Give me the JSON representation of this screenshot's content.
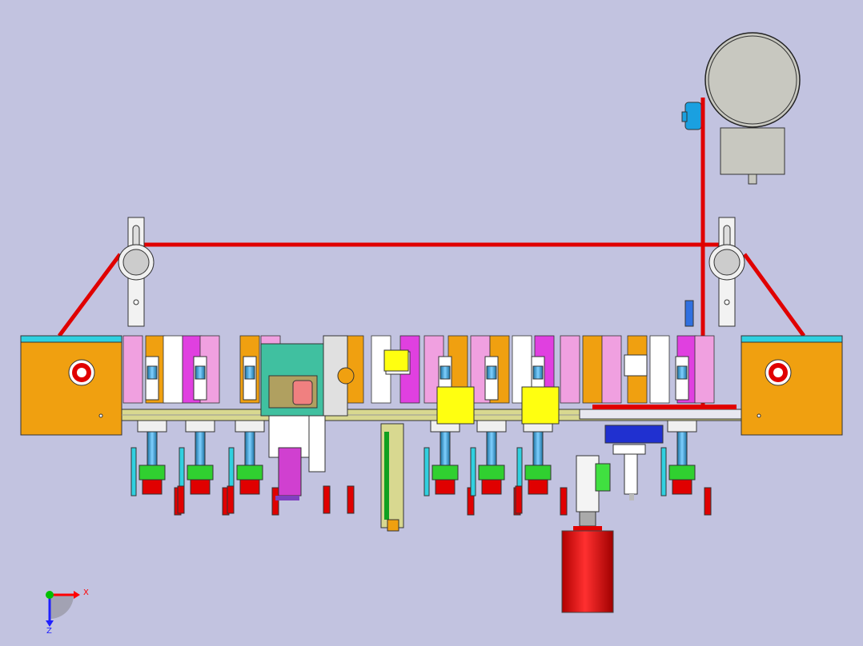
{
  "viewport": {
    "background": "#c2c3e0",
    "render_mode": "shaded-with-edges"
  },
  "triad": {
    "x_label": "X",
    "z_label": "Z",
    "x_color": "#ff0000",
    "y_color": "#00c000",
    "z_color": "#2020ff"
  },
  "model": {
    "belt_color": "#e00000",
    "frame_color": "#f0a010",
    "rail_color": "#d8d890",
    "motor_color": "#c8c8c0",
    "cylinder_color": "#e00000",
    "station_count": 12
  }
}
